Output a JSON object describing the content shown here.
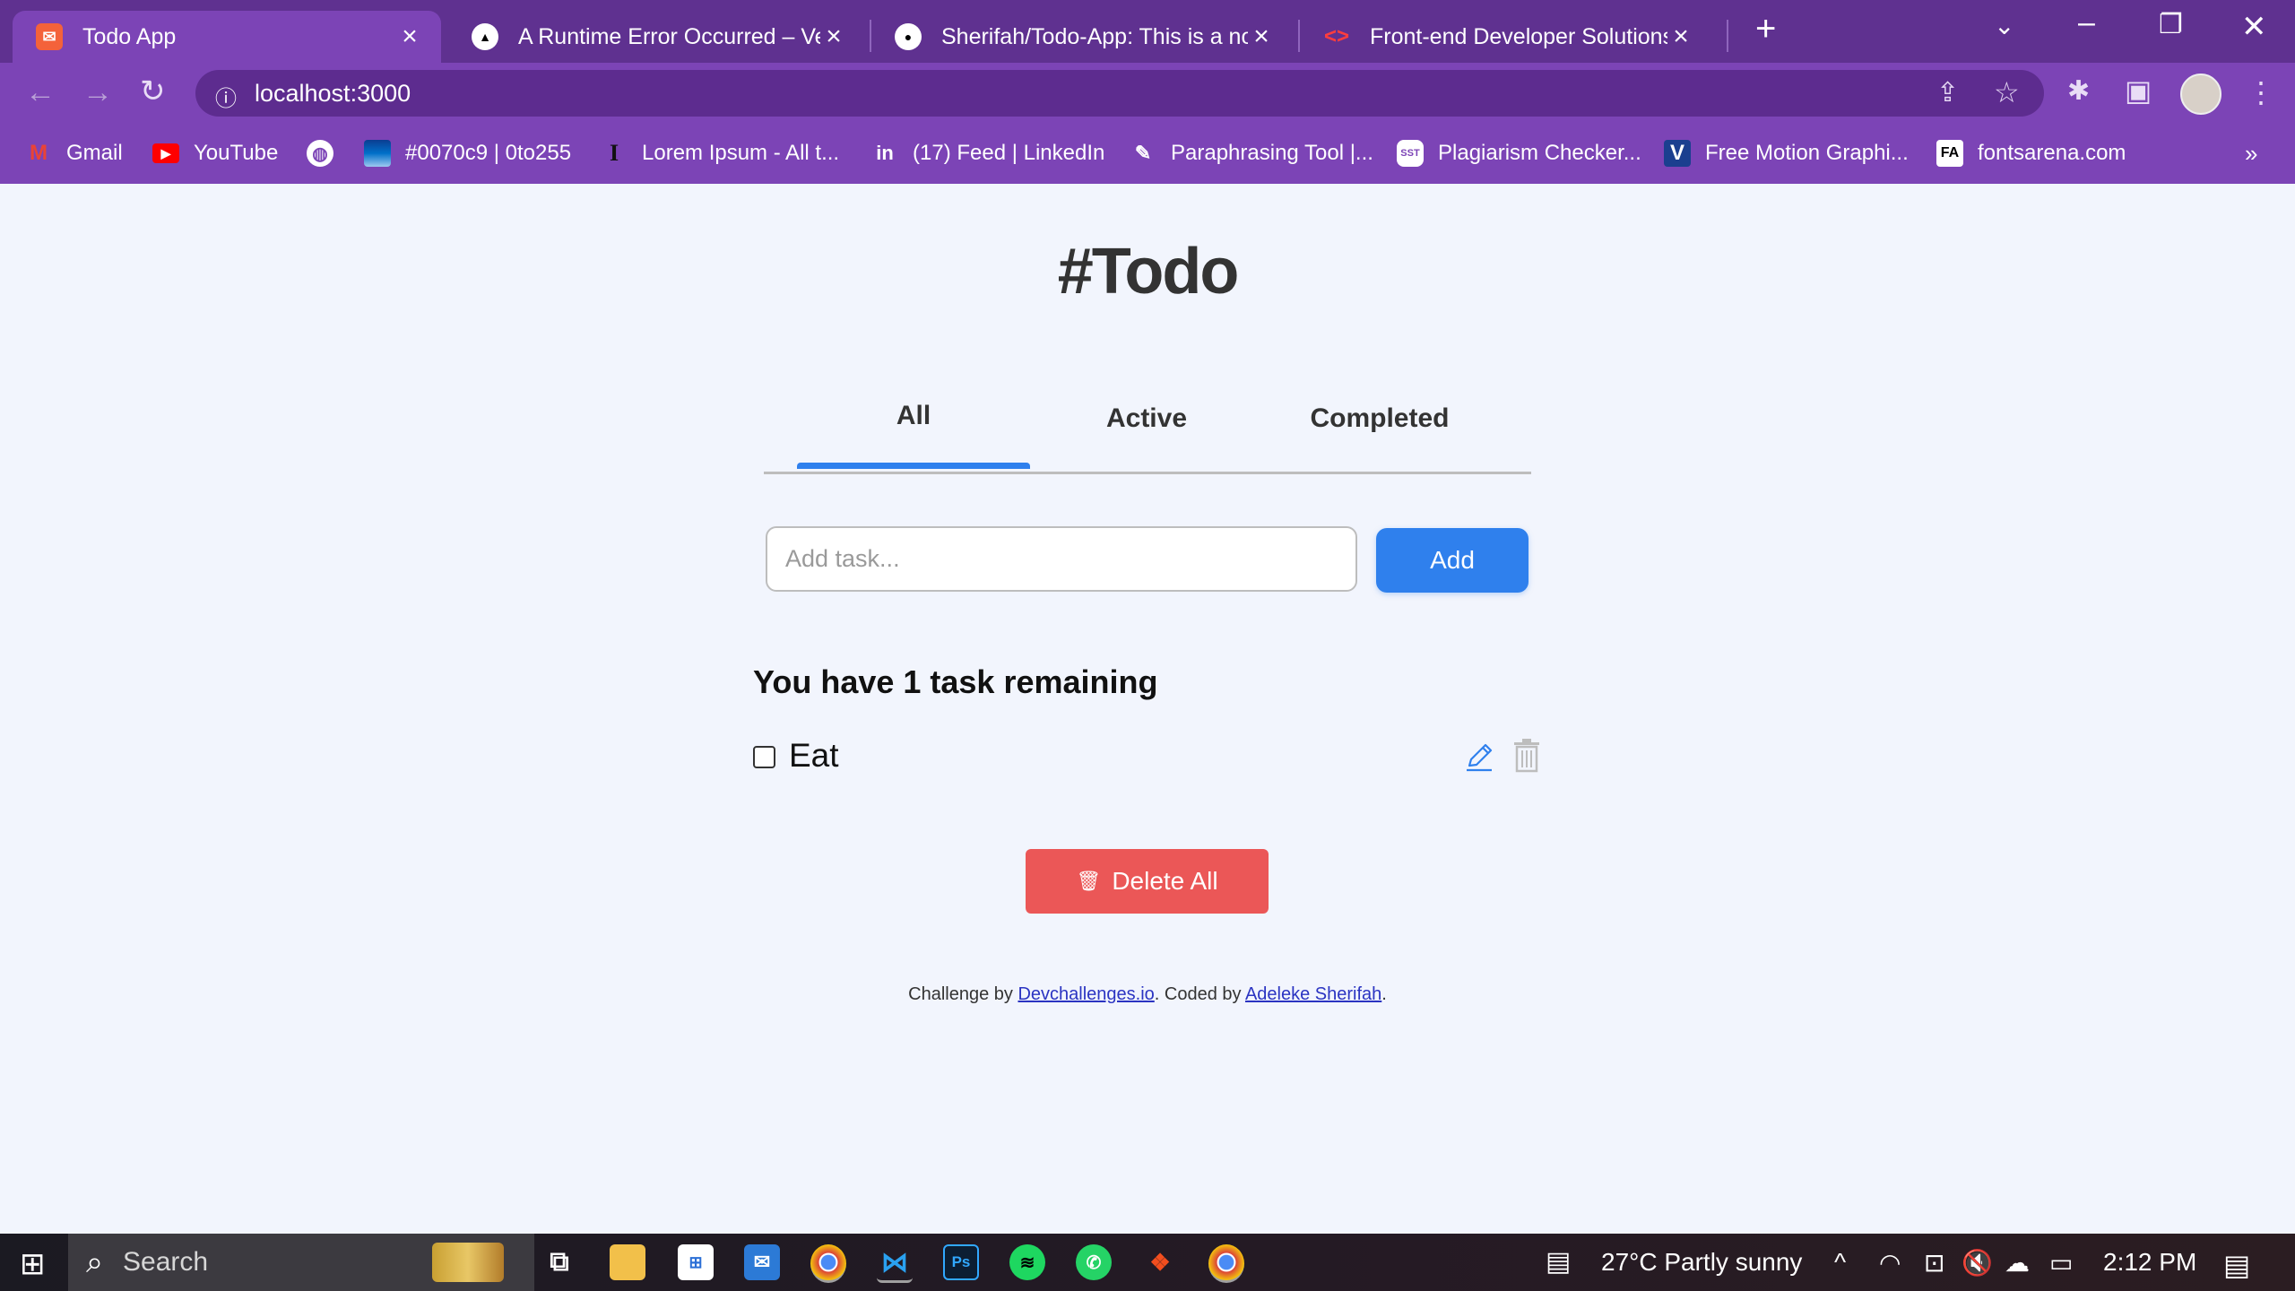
{
  "browser": {
    "tabs": [
      {
        "title": "Todo App",
        "favicon": "todo-icon",
        "active": true
      },
      {
        "title": "A Runtime Error Occurred – Verce",
        "favicon": "vercel-icon"
      },
      {
        "title": "Sherifah/Todo-App: This is a note",
        "favicon": "github-icon"
      },
      {
        "title": "Front-end Developer Solutions",
        "favicon": "code-icon"
      }
    ],
    "url": "localhost:3000",
    "bookmarks": [
      {
        "label": "Gmail",
        "icon": "gmail-icon"
      },
      {
        "label": "YouTube",
        "icon": "youtube-icon"
      },
      {
        "label": "",
        "icon": "globe-icon"
      },
      {
        "label": "#0070c9 | 0to255",
        "icon": "0to255-icon"
      },
      {
        "label": "Lorem Ipsum - All t...",
        "icon": "lorem-icon"
      },
      {
        "label": "(17) Feed | LinkedIn",
        "icon": "linkedin-icon"
      },
      {
        "label": "Paraphrasing Tool |...",
        "icon": "quill-icon"
      },
      {
        "label": "Plagiarism Checker...",
        "icon": "sst-icon"
      },
      {
        "label": "Free Motion Graphi...",
        "icon": "vecteezy-icon"
      },
      {
        "label": "fontsarena.com",
        "icon": "fontsarena-icon"
      }
    ]
  },
  "app": {
    "title": "#Todo",
    "tabs": [
      "All",
      "Active",
      "Completed"
    ],
    "active_tab": "All",
    "input_placeholder": "Add task...",
    "add_label": "Add",
    "remaining_text": "You have 1 task remaining",
    "tasks": [
      {
        "text": "Eat",
        "completed": false
      }
    ],
    "delete_all_label": "Delete All",
    "footer": {
      "prefix": "Challenge by ",
      "link1": "Devchallenges.io",
      "middle": ". Coded by ",
      "link2": "Adeleke Sherifah",
      "suffix": "."
    },
    "colors": {
      "accent": "#2f80ed",
      "danger": "#eb5757",
      "background": "#f2f5fd",
      "browser_frame": "#7c44b6"
    }
  },
  "taskbar": {
    "search_placeholder": "Search",
    "weather": "27°C  Partly sunny",
    "time": "2:12 PM"
  }
}
